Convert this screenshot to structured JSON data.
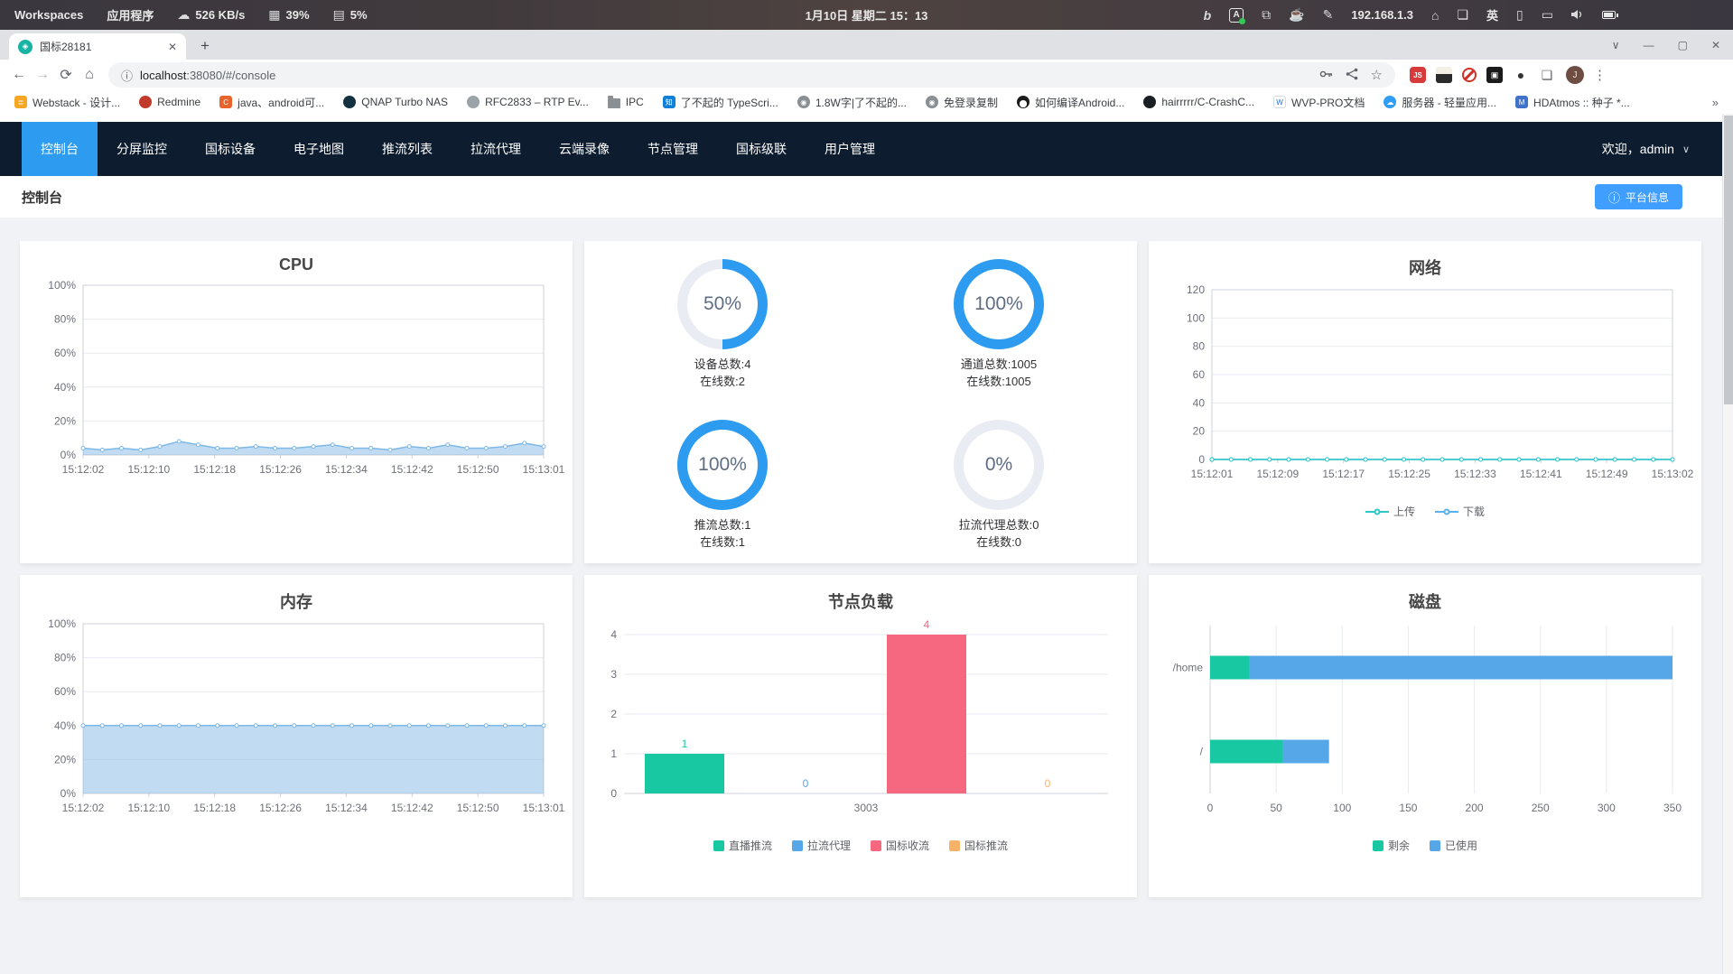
{
  "colors": {
    "accent": "#2d9cf0",
    "button": "#409eff",
    "ring": "#2d9cf0",
    "ring_track": "#e9edf3",
    "nav_bg": "#0d1c2e",
    "page_bg": "#f0f2f5"
  },
  "system_bar": {
    "workspaces_label": "Workspaces",
    "apps_label": "应用程序",
    "network_speed": "526 KB/s",
    "cpu_usage": "39%",
    "memory_usage": "5%",
    "clock": "1月10日 星期二 15：13",
    "ip_address": "192.168.1.3",
    "input_method": "英",
    "bing_label": "b"
  },
  "browser": {
    "tab_title": "国标28181",
    "url_host": "localhost",
    "url_rest": ":38080/#/console",
    "overflow": "»",
    "bookmarks": [
      {
        "label": "Webstack - 设计..."
      },
      {
        "label": "Redmine"
      },
      {
        "label": "java、android可..."
      },
      {
        "label": "QNAP Turbo NAS"
      },
      {
        "label": "RFC2833 – RTP Ev..."
      },
      {
        "label": "IPC"
      },
      {
        "label": "了不起的 TypeScri..."
      },
      {
        "label": "1.8W字|了不起的..."
      },
      {
        "label": "免登录复制"
      },
      {
        "label": "如何编译Android..."
      },
      {
        "label": "hairrrrr/C-CrashC..."
      },
      {
        "label": "WVP-PRO文档"
      },
      {
        "label": "服务器 - 轻量应用..."
      },
      {
        "label": "HDAtmos :: 种子 *..."
      }
    ],
    "bookmark_icon_letters": {
      "webstack": "≣",
      "c_blog": "C",
      "qnap": "Q",
      "zhihu": "知",
      "wvp": "W",
      "hdatmos": "M"
    }
  },
  "nav": {
    "items": [
      "控制台",
      "分屏监控",
      "国标设备",
      "电子地图",
      "推流列表",
      "拉流代理",
      "云端录像",
      "节点管理",
      "国标级联",
      "用户管理"
    ],
    "welcome": "欢迎，admin"
  },
  "page": {
    "title": "控制台",
    "platform_button": "平台信息"
  },
  "chart_data": [
    {
      "id": "cpu",
      "type": "area",
      "title": "CPU",
      "ylim": [
        0,
        100
      ],
      "yticks": [
        "100%",
        "80%",
        "60%",
        "40%",
        "20%",
        "0%"
      ],
      "x_labels": [
        "15:12:02",
        "15:12:10",
        "15:12:18",
        "15:12:26",
        "15:12:34",
        "15:12:42",
        "15:12:50",
        "15:13:01"
      ],
      "values": [
        4,
        3,
        4,
        3,
        5,
        8,
        6,
        4,
        4,
        5,
        4,
        4,
        5,
        6,
        4,
        4,
        3,
        5,
        4,
        6,
        4,
        4,
        5,
        7,
        5
      ],
      "unit": "%",
      "color": "#7db8e6",
      "fill": "rgba(131,184,229,0.5)",
      "grid": true,
      "legend": false
    },
    {
      "id": "overview-rings",
      "type": "donut-grid",
      "rings": [
        {
          "percent": 50,
          "percent_label": "50%",
          "lines": [
            "设备总数:4",
            "在线数:2"
          ]
        },
        {
          "percent": 100,
          "percent_label": "100%",
          "lines": [
            "通道总数:1005",
            "在线数:1005"
          ]
        },
        {
          "percent": 100,
          "percent_label": "100%",
          "lines": [
            "推流总数:1",
            "在线数:1"
          ]
        },
        {
          "percent": 0,
          "percent_label": "0%",
          "lines": [
            "拉流代理总数:0",
            "在线数:0"
          ]
        }
      ]
    },
    {
      "id": "network",
      "type": "line",
      "title": "网络",
      "ylim": [
        0,
        120
      ],
      "yticks": [
        "120",
        "100",
        "80",
        "60",
        "40",
        "20",
        "0"
      ],
      "x_labels": [
        "15:12:01",
        "15:12:09",
        "15:12:17",
        "15:12:25",
        "15:12:33",
        "15:12:41",
        "15:12:49",
        "15:13:02"
      ],
      "series": [
        {
          "name": "上传",
          "color": "#2ec7c9",
          "values": [
            0,
            0,
            0,
            0,
            0,
            0,
            0,
            0,
            0,
            0,
            0,
            0,
            0,
            0,
            0,
            0,
            0,
            0,
            0,
            0,
            0,
            0,
            0,
            0,
            0
          ]
        },
        {
          "name": "下载",
          "color": "#5ab1ef",
          "values": [
            0,
            0,
            0,
            0,
            0,
            0,
            0,
            0,
            0,
            0,
            0,
            0,
            0,
            0,
            0,
            0,
            0,
            0,
            0,
            0,
            0,
            0,
            0,
            0,
            0
          ]
        }
      ],
      "legend_position": "bottom",
      "grid": true
    },
    {
      "id": "memory",
      "type": "area",
      "title": "内存",
      "ylim": [
        0,
        100
      ],
      "yticks": [
        "100%",
        "80%",
        "60%",
        "40%",
        "20%",
        "0%"
      ],
      "x_labels": [
        "15:12:02",
        "15:12:10",
        "15:12:18",
        "15:12:26",
        "15:12:34",
        "15:12:42",
        "15:12:50",
        "15:13:01"
      ],
      "values": [
        40,
        40,
        40,
        40,
        40,
        40,
        40,
        40,
        40,
        40,
        40,
        40,
        40,
        40,
        40,
        40,
        40,
        40,
        40,
        40,
        40,
        40,
        40,
        40,
        40
      ],
      "unit": "%",
      "color": "#7db8e6",
      "fill": "rgba(131,184,229,0.5)",
      "grid": true,
      "legend": false
    },
    {
      "id": "load",
      "type": "bar",
      "title": "节点负载",
      "ylim": [
        0,
        4
      ],
      "yticks": [
        "4",
        "3",
        "2",
        "1",
        "0"
      ],
      "categories": [
        "3003"
      ],
      "series": [
        {
          "name": "直播推流",
          "color": "#18c8a2",
          "values": [
            1
          ]
        },
        {
          "name": "拉流代理",
          "color": "#55a7e8",
          "values": [
            0
          ]
        },
        {
          "name": "国标收流",
          "color": "#f5687f",
          "values": [
            4
          ]
        },
        {
          "name": "国标推流",
          "color": "#f7b267",
          "values": [
            0
          ]
        }
      ],
      "legend_position": "bottom"
    },
    {
      "id": "disk",
      "type": "hbar",
      "title": "磁盘",
      "xlim": [
        0,
        350
      ],
      "xticks": [
        "0",
        "50",
        "100",
        "150",
        "200",
        "250",
        "300",
        "350"
      ],
      "categories": [
        "/home",
        "/"
      ],
      "series": [
        {
          "name": "剩余",
          "color": "#18c8a2",
          "values": [
            30,
            55
          ]
        },
        {
          "name": "已使用",
          "color": "#55a7e8",
          "values": [
            320,
            35
          ]
        }
      ],
      "legend_position": "bottom"
    }
  ]
}
